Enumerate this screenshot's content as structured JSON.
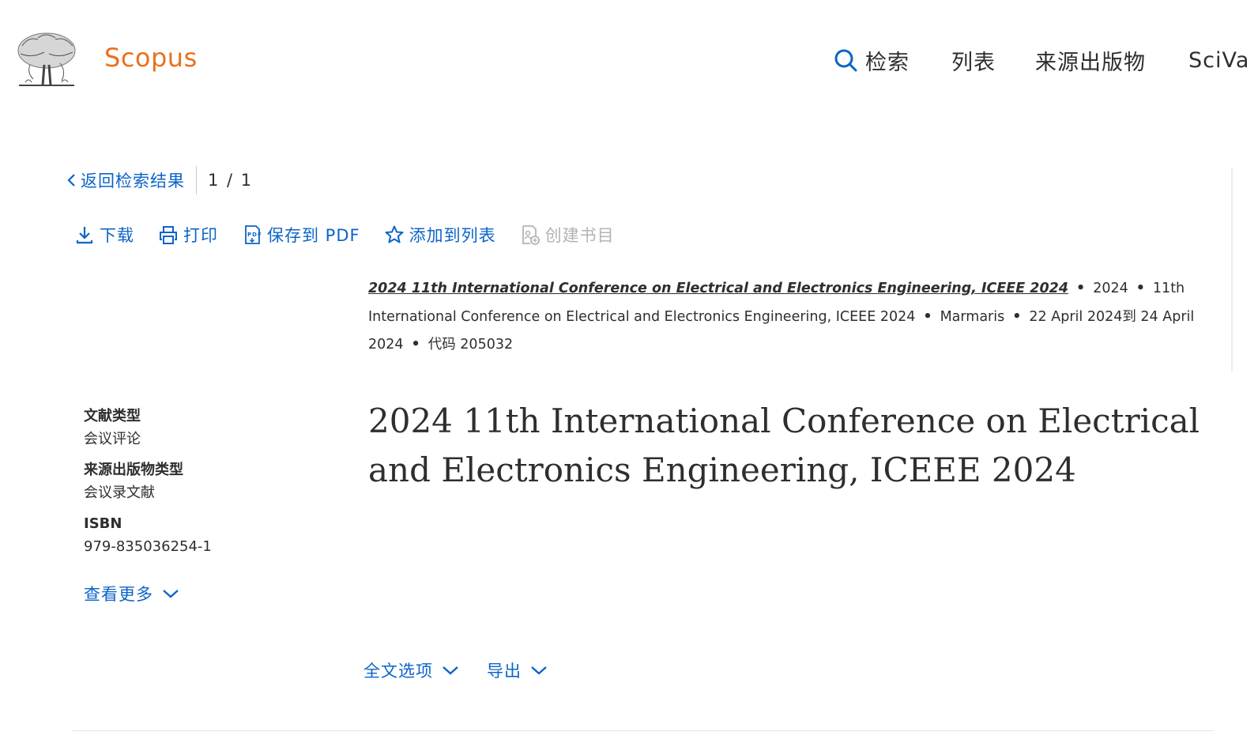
{
  "header": {
    "brand": "Scopus",
    "nav": {
      "search": "检索",
      "lists": "列表",
      "sources": "来源出版物",
      "scival": "SciVa"
    }
  },
  "back_row": {
    "back_label": "返回检索结果",
    "pager": "1 / 1"
  },
  "toolbar": {
    "download": "下载",
    "print": "打印",
    "save_pdf": "保存到 PDF",
    "add_list": "添加到列表",
    "create_bib": "创建书目"
  },
  "source": {
    "title_link": "2024 11th International Conference on Electrical and Electronics Engineering, ICEEE 2024",
    "year": "2024",
    "conference": "11th International Conference on Electrical and Electronics Engineering, ICEEE 2024",
    "location": "Marmaris",
    "dates": "22 April 2024到 24 April 2024",
    "code": "代码 205032"
  },
  "meta": {
    "doc_type_label": "文献类型",
    "doc_type_value": "会议评论",
    "source_type_label": "来源出版物类型",
    "source_type_value": "会议录文献",
    "isbn_label": "ISBN",
    "isbn_value": "979-835036254-1",
    "see_more": "查看更多"
  },
  "main_title": "2024 11th International Conference on Electrical and Electronics Engineering, ICEEE 2024",
  "actions": {
    "full_text": "全文选项",
    "export": "导出"
  },
  "colors": {
    "link": "#0b64c8",
    "brand": "#e9711c",
    "text": "#2e2e2e",
    "disabled": "#b3b3b3"
  },
  "icons": [
    "elsevier-tree-logo",
    "search-icon",
    "chevron-left-icon",
    "download-icon",
    "print-icon",
    "pdf-icon",
    "star-icon",
    "bibliography-icon",
    "chevron-down-icon"
  ]
}
